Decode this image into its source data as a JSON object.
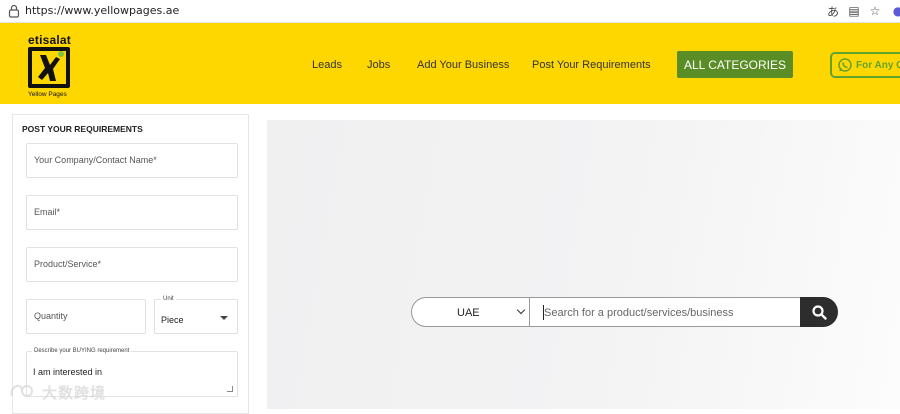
{
  "browser": {
    "url": "https://www.yellowpages.ae",
    "icons": [
      "lock-icon",
      "translate-icon",
      "reader-icon",
      "star-icon",
      "profile-icon"
    ]
  },
  "header": {
    "logo_brand": "etisalat",
    "logo_caption": "Yellow Pages",
    "nav": [
      "Leads",
      "Jobs",
      "Add Your Business",
      "Post Your Requirements"
    ],
    "all_categories": "ALL CATEGORIES",
    "whatsapp_label": "For Any Qu",
    "colors": {
      "header_bg": "#fed700",
      "accent_green": "#5a8d26"
    }
  },
  "form": {
    "title": "POST YOUR REQUIREMENTS",
    "company_placeholder": "Your Company/Contact Name*",
    "email_placeholder": "Email*",
    "product_placeholder": "Product/Service*",
    "quantity_placeholder": "Quantity",
    "unit_label": "Unit",
    "unit_value": "Piece",
    "description_label": "Describe your BUYING requirement",
    "description_value": "I am interested in"
  },
  "search": {
    "country": "UAE",
    "placeholder": "Search for a product/services/business"
  },
  "watermark": {
    "text": "大数跨境"
  }
}
